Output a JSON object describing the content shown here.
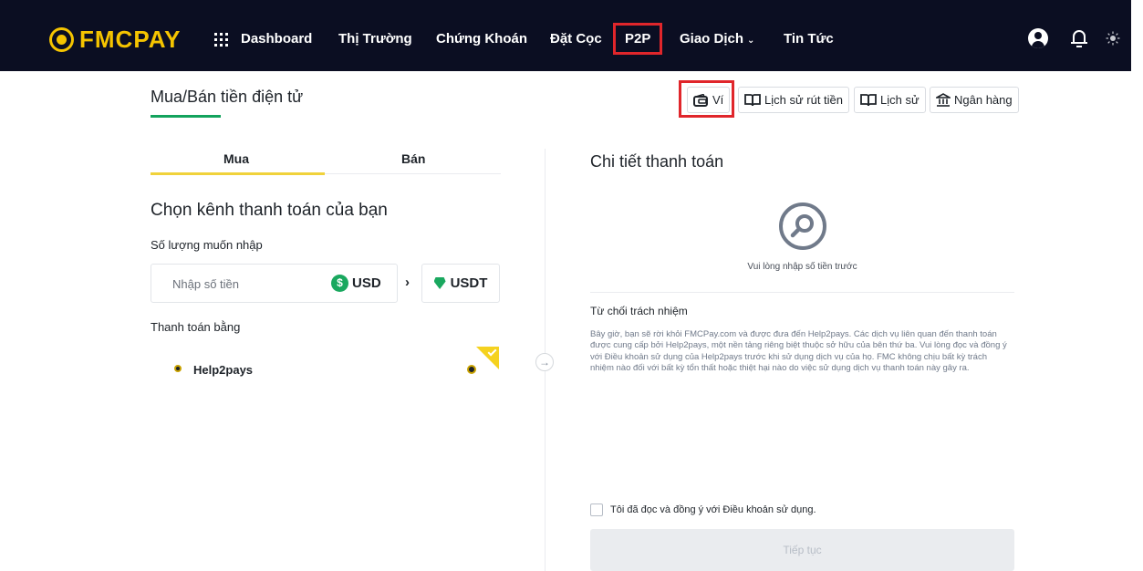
{
  "header": {
    "logo_text": "FMCPAY",
    "nav": [
      {
        "label": "Dashboard"
      },
      {
        "label": "Thị Trường"
      },
      {
        "label": "Chứng Khoán"
      },
      {
        "label": "Đặt Cọc"
      },
      {
        "label": "P2P"
      },
      {
        "label": "Giao Dịch"
      },
      {
        "label": "Tin Tức"
      }
    ],
    "icons": [
      "grid-icon",
      "user-icon",
      "bell-icon",
      "sun-icon"
    ]
  },
  "page": {
    "title": "Mua/Bán tiền điện tử",
    "toolbar": {
      "vi": "Ví",
      "withdraw_history": "Lịch sử rút tiền",
      "history": "Lịch sử",
      "bank": "Ngân hàng"
    }
  },
  "left": {
    "tabs": {
      "buy": "Mua",
      "sell": "Bán"
    },
    "section_title": "Chọn kênh thanh toán của bạn",
    "amount_label": "Số lượng muốn nhập",
    "amount_placeholder": "Nhập số tiền",
    "from_currency": "USD",
    "to_currency": "USDT",
    "pay_label": "Thanh toán bằng",
    "pay_method": "Help2pays"
  },
  "right": {
    "title": "Chi tiết thanh toán",
    "hint": "Vui lòng nhập số tiền trước",
    "disclaimer_title": "Từ chối trách nhiệm",
    "disclaimer": "Bây giờ, bạn sẽ rời khỏi FMCPay.com và được đưa đến Help2pays. Các dịch vụ liên quan đến thanh toán được cung cấp bởi Help2pays, một nền tảng riêng biệt thuộc sở hữu của bên thứ ba. Vui lòng đọc và đồng ý với Điều khoản sử dụng của Help2pays trước khi sử dụng dịch vụ của họ. FMC không chịu bất kỳ trách nhiệm nào đối với bất kỳ tổn thất hoặc thiệt hại nào do việc sử dụng dịch vụ thanh toán này gây ra.",
    "agree": "Tôi đã đọc và đồng ý với Điều khoản sử dụng.",
    "continue": "Tiếp tục"
  },
  "colors": {
    "header_bg": "#0b0e22",
    "brand_yellow": "#f5c400",
    "highlight_red": "#e0262b",
    "green": "#13a35d"
  }
}
